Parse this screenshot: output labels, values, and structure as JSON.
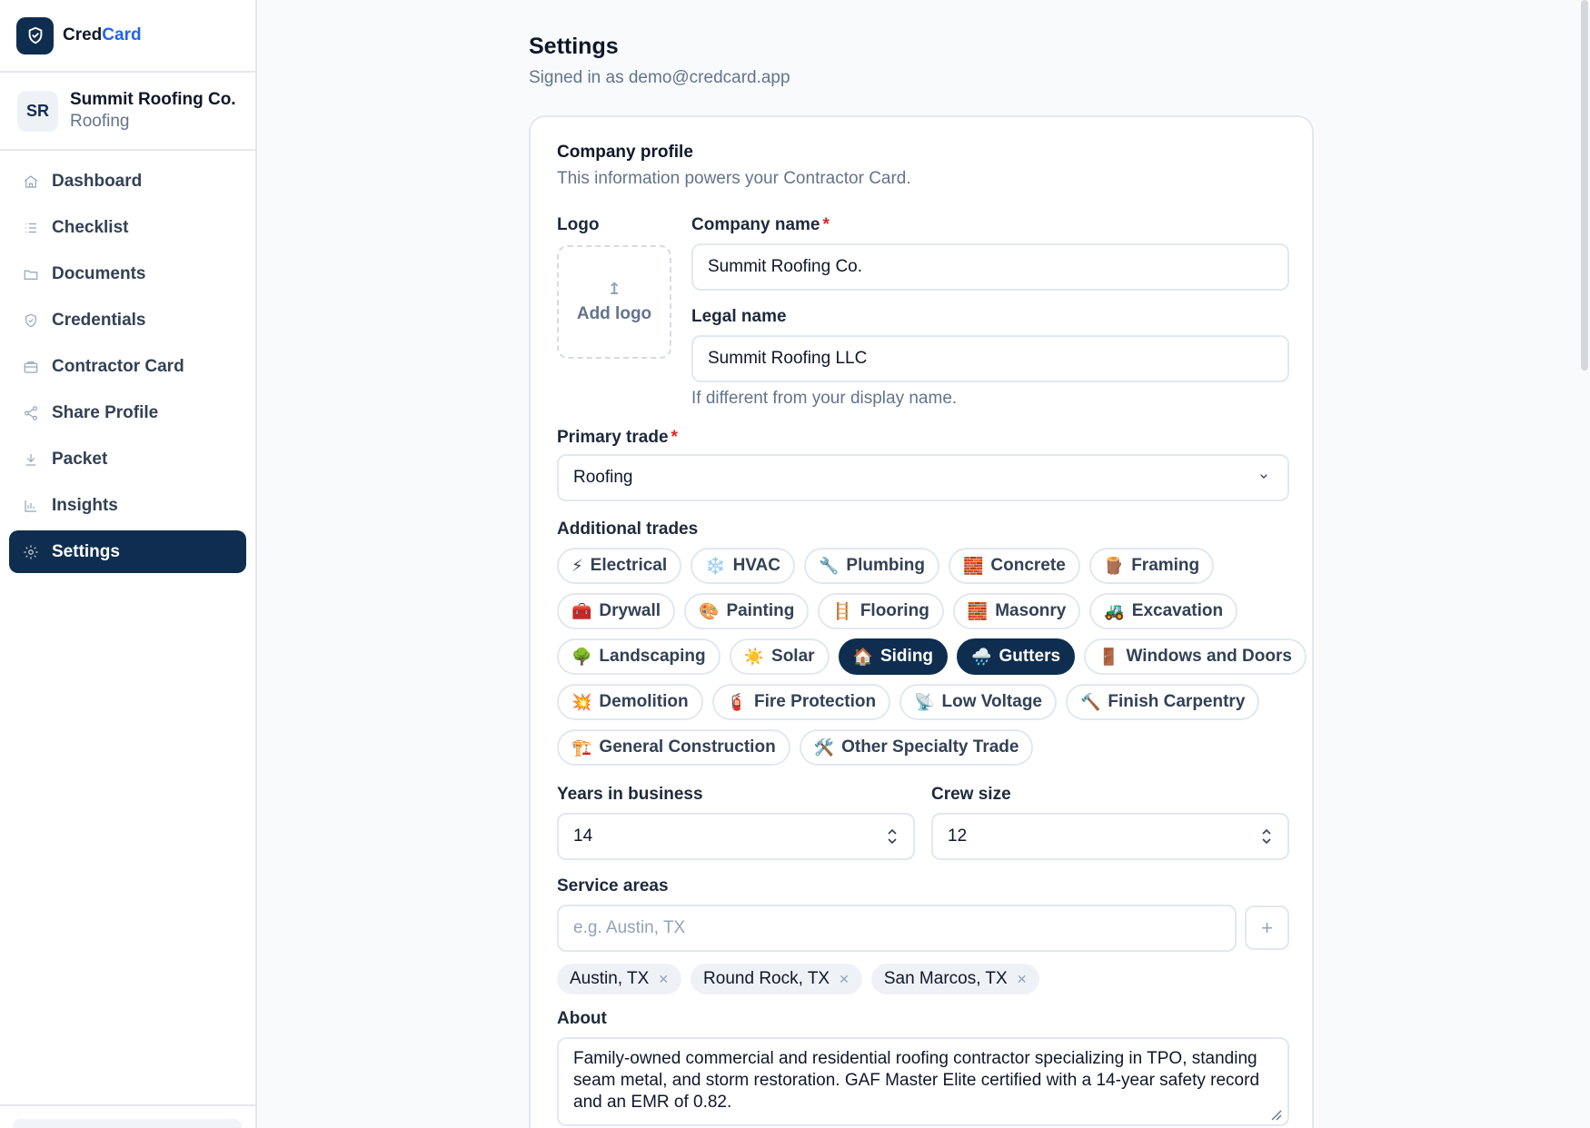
{
  "brand": {
    "name_part1": "Cred",
    "name_part2": "Card"
  },
  "org": {
    "initials": "SR",
    "name": "Summit Roofing Co.",
    "trade": "Roofing"
  },
  "nav": [
    {
      "label": "Dashboard",
      "icon": "home-icon"
    },
    {
      "label": "Checklist",
      "icon": "list-icon"
    },
    {
      "label": "Documents",
      "icon": "folder-icon"
    },
    {
      "label": "Credentials",
      "icon": "shield-icon"
    },
    {
      "label": "Contractor Card",
      "icon": "card-icon"
    },
    {
      "label": "Share Profile",
      "icon": "share-icon"
    },
    {
      "label": "Packet",
      "icon": "download-icon"
    },
    {
      "label": "Insights",
      "icon": "bar-chart-icon"
    },
    {
      "label": "Settings",
      "icon": "gear-icon",
      "active": true
    }
  ],
  "page": {
    "title": "Settings",
    "subtitle": "Signed in as demo@credcard.app"
  },
  "profile": {
    "title": "Company profile",
    "subtitle": "This information powers your Contractor Card.",
    "logo_label": "Logo",
    "add_logo": "Add logo",
    "company_name_label": "Company name",
    "company_name": "Summit Roofing Co.",
    "legal_name_label": "Legal name",
    "legal_name": "Summit Roofing LLC",
    "legal_help": "If different from your display name.",
    "primary_trade_label": "Primary trade",
    "primary_trade": "Roofing",
    "additional_trades_label": "Additional trades",
    "trades": [
      {
        "emoji": "⚡",
        "label": "Electrical",
        "selected": false
      },
      {
        "emoji": "❄️",
        "label": "HVAC",
        "selected": false
      },
      {
        "emoji": "🔧",
        "label": "Plumbing",
        "selected": false
      },
      {
        "emoji": "🧱",
        "label": "Concrete",
        "selected": false
      },
      {
        "emoji": "🪵",
        "label": "Framing",
        "selected": false
      },
      {
        "emoji": "🧰",
        "label": "Drywall",
        "selected": false
      },
      {
        "emoji": "🎨",
        "label": "Painting",
        "selected": false
      },
      {
        "emoji": "🪜",
        "label": "Flooring",
        "selected": false
      },
      {
        "emoji": "🧱",
        "label": "Masonry",
        "selected": false
      },
      {
        "emoji": "🚜",
        "label": "Excavation",
        "selected": false
      },
      {
        "emoji": "🌳",
        "label": "Landscaping",
        "selected": false
      },
      {
        "emoji": "☀️",
        "label": "Solar",
        "selected": false
      },
      {
        "emoji": "🏠",
        "label": "Siding",
        "selected": true
      },
      {
        "emoji": "🌧️",
        "label": "Gutters",
        "selected": true
      },
      {
        "emoji": "🚪",
        "label": "Windows and Doors",
        "selected": false
      },
      {
        "emoji": "💥",
        "label": "Demolition",
        "selected": false
      },
      {
        "emoji": "🧯",
        "label": "Fire Protection",
        "selected": false
      },
      {
        "emoji": "📡",
        "label": "Low Voltage",
        "selected": false
      },
      {
        "emoji": "🔨",
        "label": "Finish Carpentry",
        "selected": false
      },
      {
        "emoji": "🏗️",
        "label": "General Construction",
        "selected": false
      },
      {
        "emoji": "🛠️",
        "label": "Other Specialty Trade",
        "selected": false
      }
    ],
    "years_label": "Years in business",
    "years": "14",
    "crew_label": "Crew size",
    "crew": "12",
    "service_areas_label": "Service areas",
    "service_area_placeholder": "e.g. Austin, TX",
    "service_areas": [
      "Austin, TX",
      "Round Rock, TX",
      "San Marcos, TX"
    ],
    "about_label": "About",
    "about": "Family-owned commercial and residential roofing contractor specializing in TPO, standing seam metal, and storm restoration. GAF Master Elite certified with a 14-year safety record and an EMR of 0.82."
  },
  "colors": {
    "navy": "#0f2e4f",
    "accent": "#2563eb",
    "required": "#dc2626"
  }
}
